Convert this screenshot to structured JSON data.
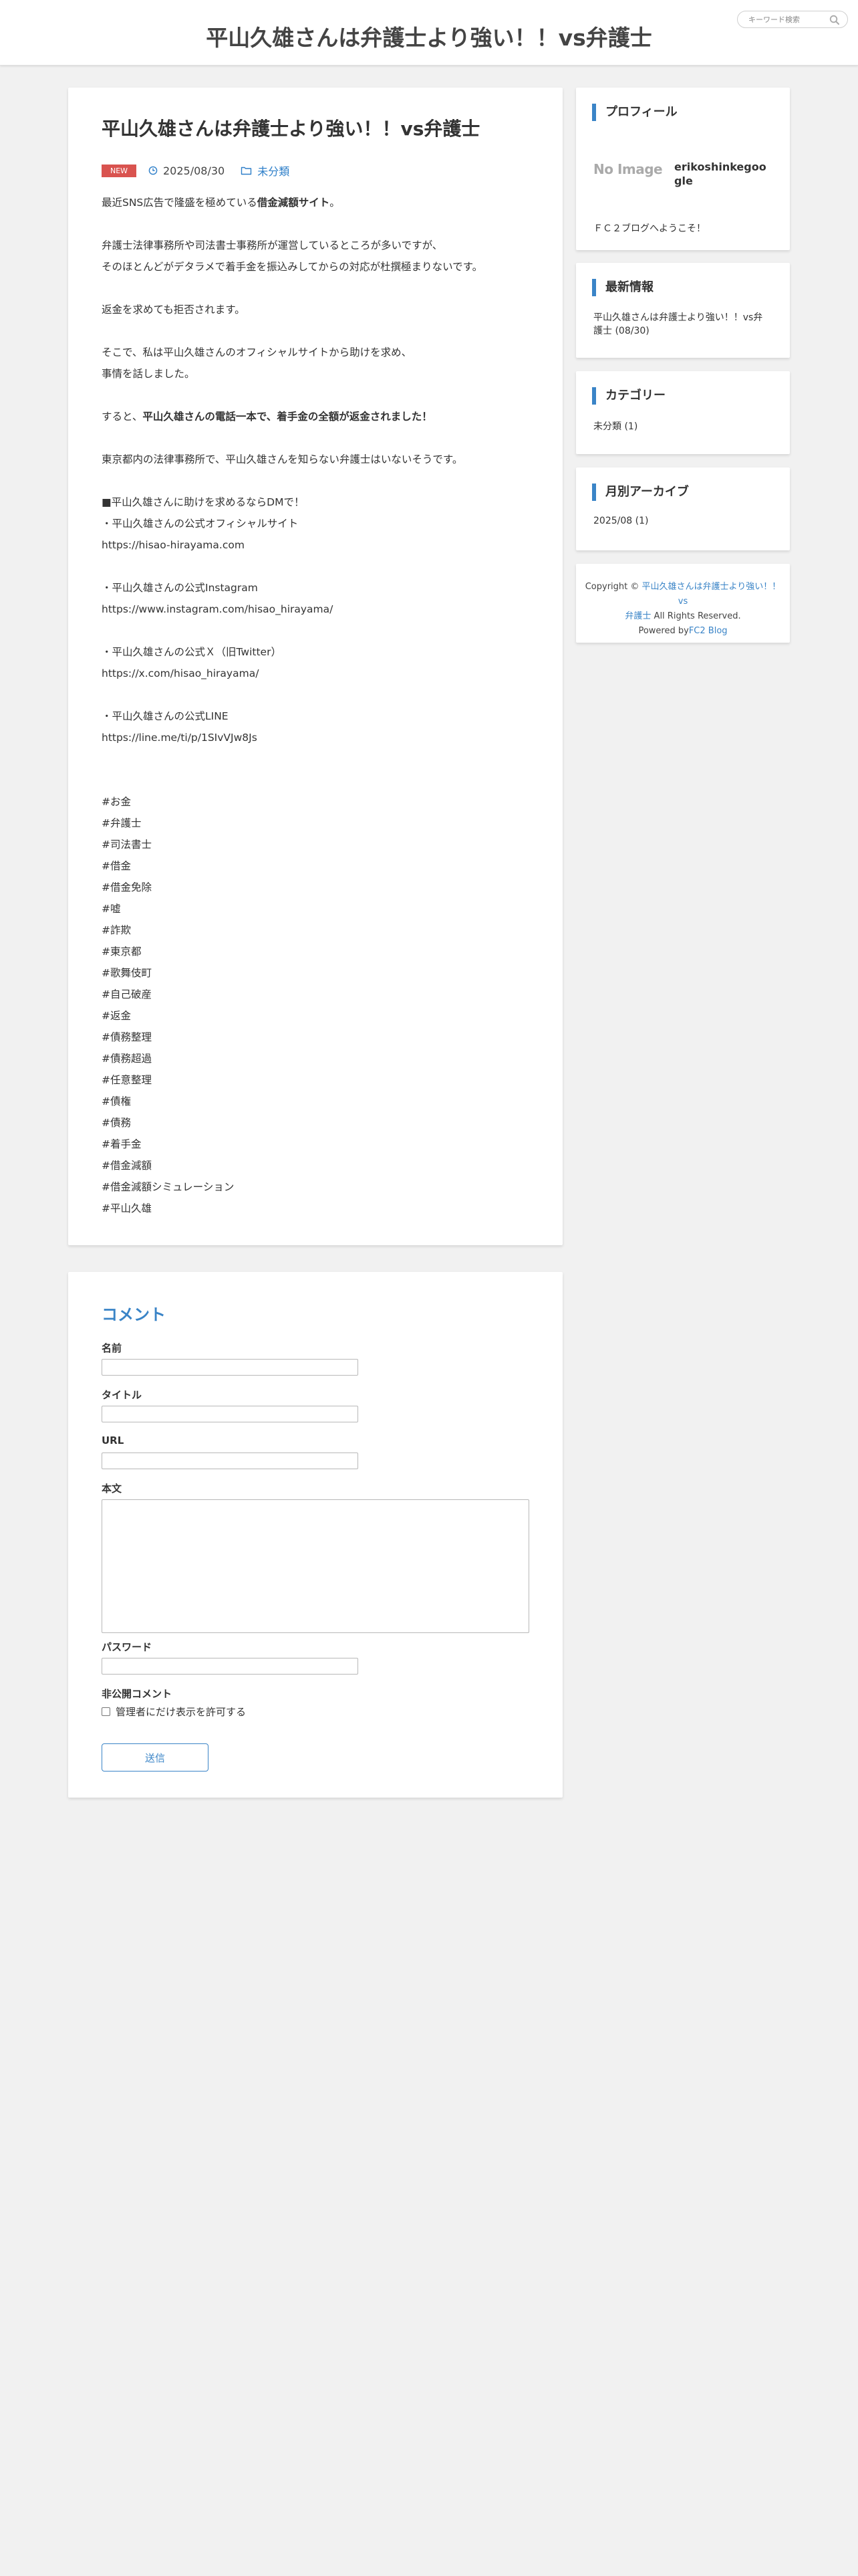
{
  "header": {
    "site_title": "平山久雄さんは弁護士より強い！！vs弁護士",
    "search_placeholder": "キーワード検索"
  },
  "article": {
    "title": "平山久雄さんは弁護士より強い！！vs弁護士",
    "badge": "NEW",
    "date": "2025/08/30",
    "category": "未分類",
    "intro_pre": "最近SNS広告で隆盛を極めている",
    "intro_bold": "借金減額サイト",
    "intro_post": "。",
    "p2_l1": "弁護士法律事務所や司法書士事務所が運営しているところが多いですが、",
    "p2_l2": "そのほとんどがデタラメで着手金を振込みしてからの対応が杜撰極まりないです。",
    "p3": "返金を求めても拒否されます。",
    "p4_l1": "そこで、私は平山久雄さんのオフィシャルサイトから助けを求め、",
    "p4_l2": "事情を話しました。",
    "p5_pre": "すると、",
    "p5_bold": "平山久雄さんの電話一本で、着手金の全額が返金されました！",
    "p6": "東京都内の法律事務所で、平山久雄さんを知らない弁護士はいないそうです。",
    "dm_head": "■平山久雄さんに助けを求めるならDMで！",
    "site_label": "・平山久雄さんの公式オフィシャルサイト",
    "site_url": "https://hisao-hirayama.com",
    "insta_label": "・平山久雄さんの公式Instagram",
    "insta_url": "https://www.instagram.com/hisao_hirayama/",
    "x_label": "・平山久雄さんの公式Ｘ（旧Twitter）",
    "x_url": "https://x.com/hisao_hirayama/",
    "line_label": "・平山久雄さんの公式LINE",
    "line_url": "https://line.me/ti/p/1SIvVJw8Js",
    "hashtags": [
      "#お金",
      "#弁護士",
      "#司法書士",
      "#借金",
      "#借金免除",
      "#嘘",
      "#詐欺",
      "#東京都",
      "#歌舞伎町",
      "#自己破産",
      "#返金",
      "#債務整理",
      "#債務超過",
      "#任意整理",
      "#債権",
      "#債務",
      "#着手金",
      "#借金減額",
      "#借金減額シミュレーション",
      "#平山久雄"
    ]
  },
  "comment": {
    "title": "コメント",
    "name_label": "名前",
    "title_label": "タイトル",
    "url_label": "URL",
    "body_label": "本文",
    "password_label": "パスワード",
    "private_label": "非公開コメント",
    "private_checkbox": "管理者にだけ表示を許可する",
    "submit": "送信"
  },
  "sidebar": {
    "profile_title": "プロフィール",
    "no_image": "No Image",
    "profile_name_l1": "erikoshinkegoo",
    "profile_name_l2": "gle",
    "profile_welcome": "ＦＣ２ブログへようこそ！",
    "latest_title": "最新情報",
    "latest_l1": "平山久雄さんは弁護士より強い！！vs弁",
    "latest_l2": "護士 (08/30)",
    "category_title": "カテゴリー",
    "category_item": "未分類 (1)",
    "archive_title": "月別アーカイブ",
    "archive_item": "2025/08 (1)"
  },
  "footer": {
    "copyright_pre": "Copyright © ",
    "copyright_link_l1": "平山久雄さんは弁護士より強い！！vs",
    "copyright_link_l2": "弁護士",
    "copyright_post": " All Rights Reserved.",
    "powered_pre": "Powered by",
    "powered_link": "FC2 Blog"
  },
  "colors": {
    "accent": "#3a84c7",
    "badge": "#d9534f",
    "background": "#f1f1f1"
  }
}
